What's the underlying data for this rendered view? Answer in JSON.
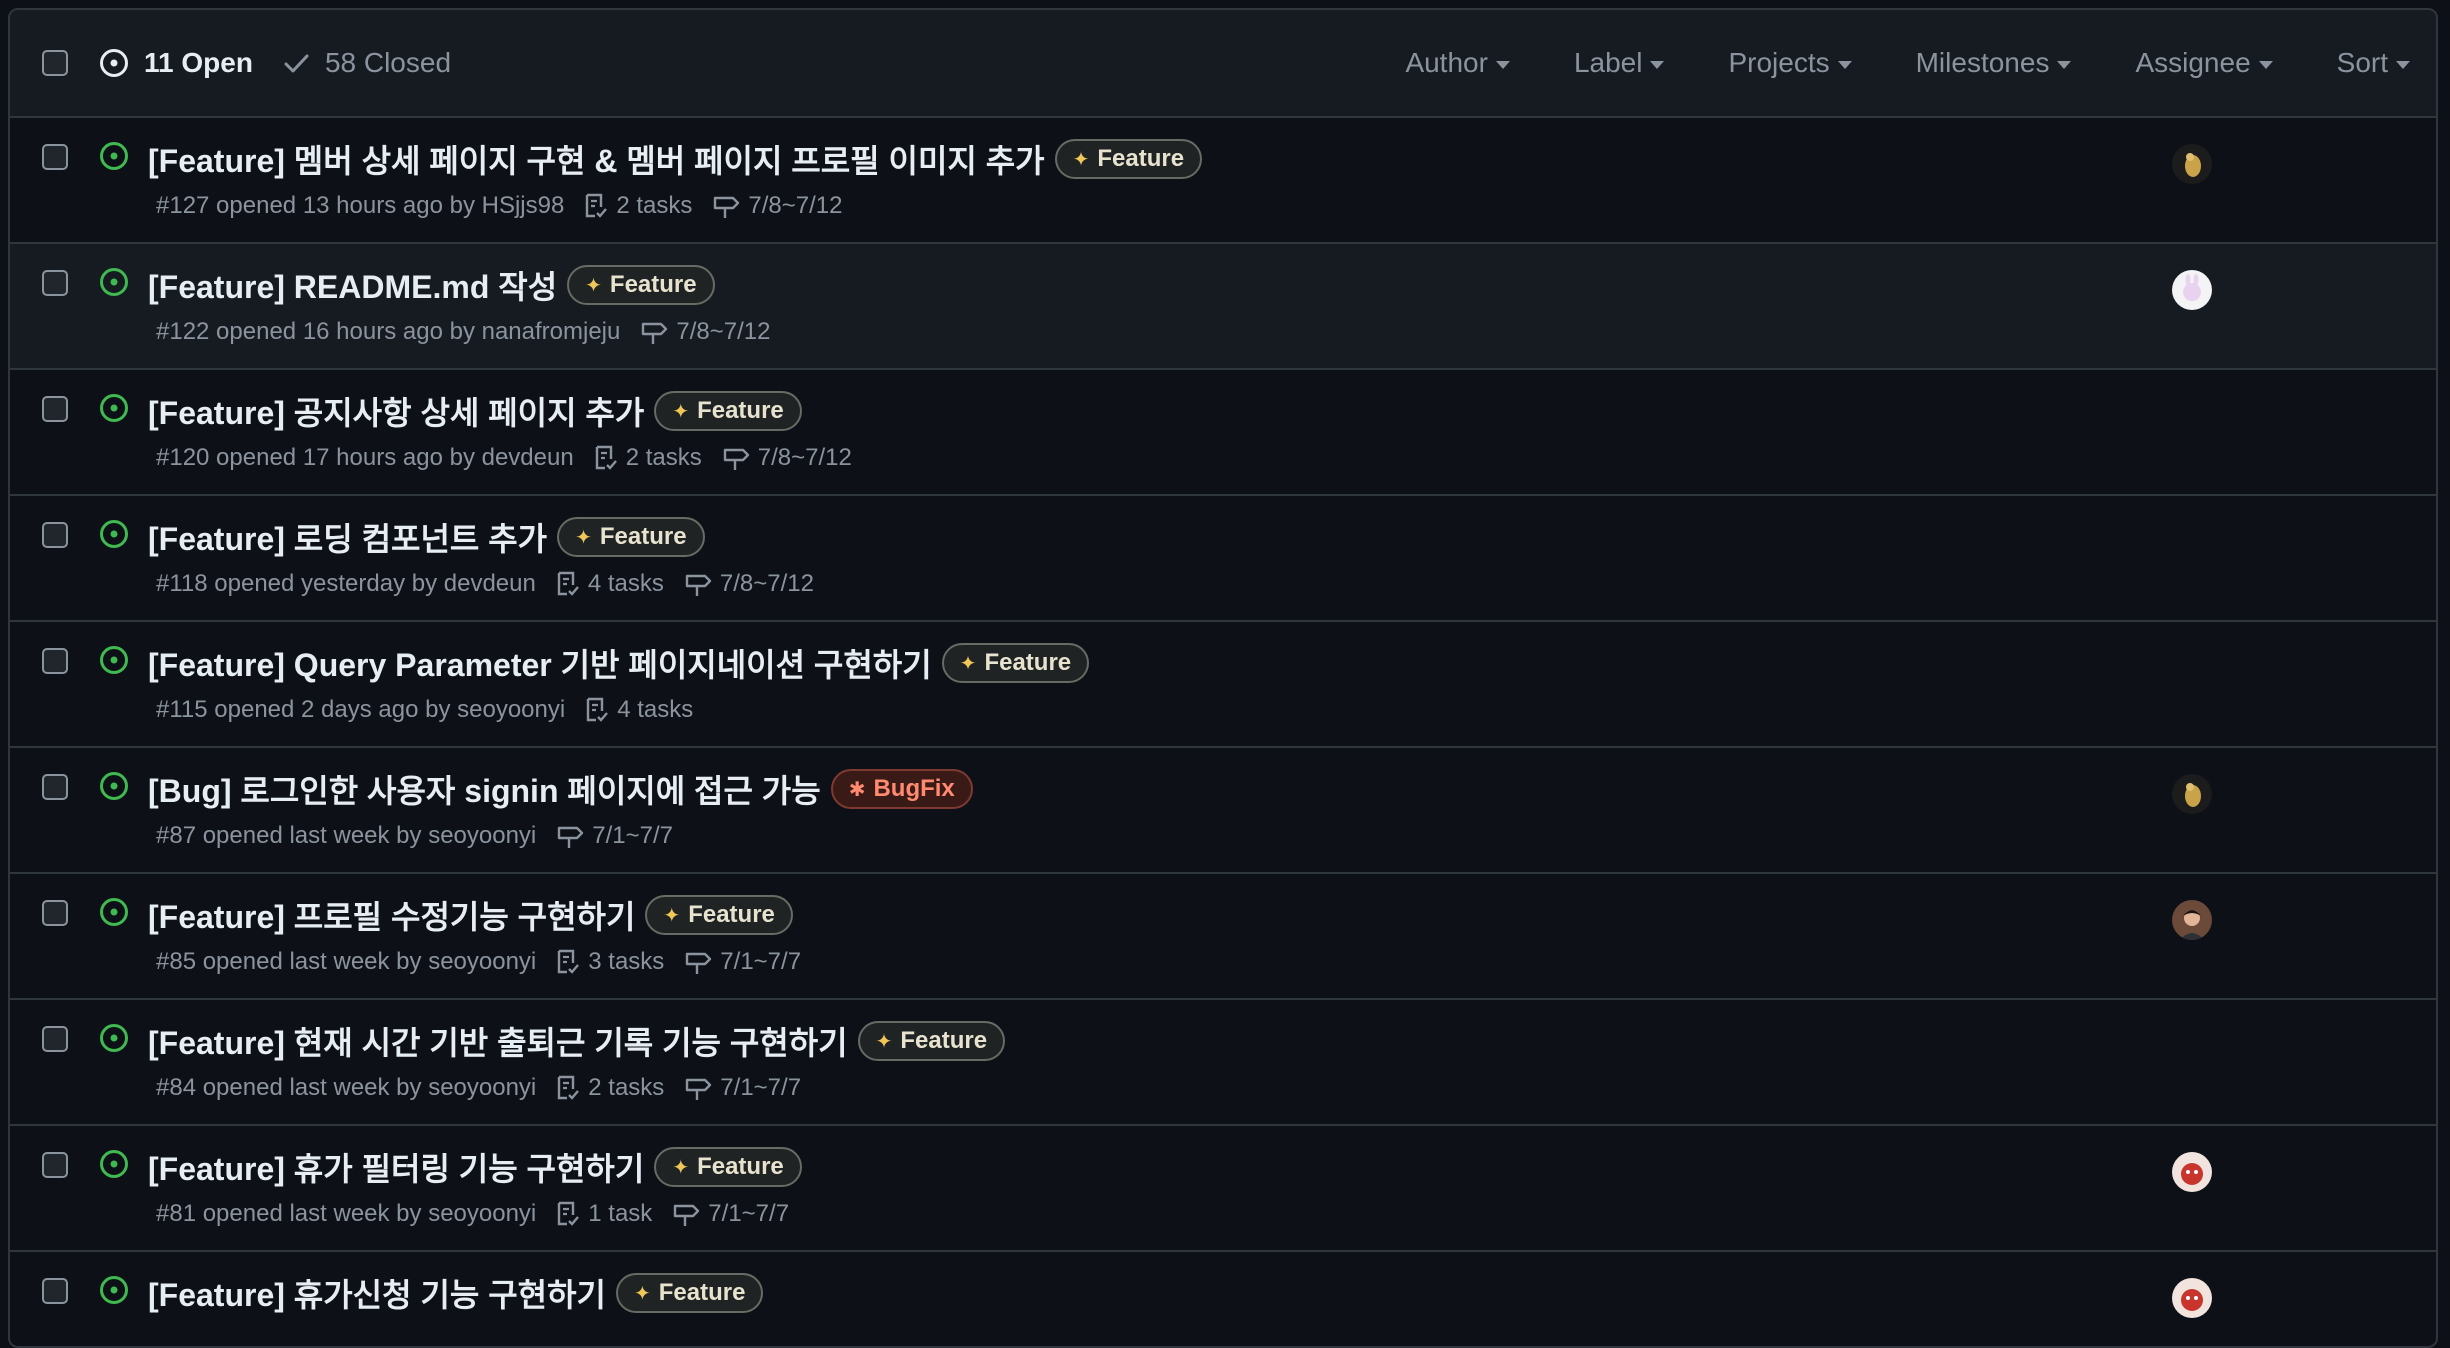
{
  "header": {
    "open_label": "11 Open",
    "closed_label": "58 Closed",
    "filters": [
      "Author",
      "Label",
      "Projects",
      "Milestones",
      "Assignee",
      "Sort"
    ]
  },
  "issues": [
    {
      "title": "[Feature] 멤버 상세 페이지 구현 & 멤버 페이지 프로필 이미지 추가",
      "label": "Feature",
      "meta": "#127 opened 13 hours ago by HSjjs98",
      "tasks": "2 tasks",
      "milestone": "7/8~7/12",
      "avatar": "bird"
    },
    {
      "title": "[Feature] README.md 작성",
      "label": "Feature",
      "meta": "#122 opened 16 hours ago by nanafromjeju",
      "tasks": "",
      "milestone": "7/8~7/12",
      "avatar": "rabbit"
    },
    {
      "title": "[Feature] 공지사항 상세 페이지 추가",
      "label": "Feature",
      "meta": "#120 opened 17 hours ago by devdeun",
      "tasks": "2 tasks",
      "milestone": "7/8~7/12",
      "avatar": ""
    },
    {
      "title": "[Feature] 로딩 컴포넌트 추가",
      "label": "Feature",
      "meta": "#118 opened yesterday by devdeun",
      "tasks": "4 tasks",
      "milestone": "7/8~7/12",
      "avatar": ""
    },
    {
      "title": "[Feature] Query Parameter 기반 페이지네이션 구현하기",
      "label": "Feature",
      "meta": "#115 opened 2 days ago by seoyoonyi",
      "tasks": "4 tasks",
      "milestone": "",
      "avatar": ""
    },
    {
      "title": "[Bug] 로그인한 사용자 signin 페이지에 접근 가능",
      "label": "BugFix",
      "meta": "#87 opened last week by seoyoonyi",
      "tasks": "",
      "milestone": "7/1~7/7",
      "avatar": "bird"
    },
    {
      "title": "[Feature] 프로필 수정기능 구현하기",
      "label": "Feature",
      "meta": "#85 opened last week by seoyoonyi",
      "tasks": "3 tasks",
      "milestone": "7/1~7/7",
      "avatar": "person"
    },
    {
      "title": "[Feature] 현재 시간 기반 출퇴근 기록 기능 구현하기",
      "label": "Feature",
      "meta": "#84 opened last week by seoyoonyi",
      "tasks": "2 tasks",
      "milestone": "7/1~7/7",
      "avatar": ""
    },
    {
      "title": "[Feature] 휴가 필터링 기능 구현하기",
      "label": "Feature",
      "meta": "#81 opened last week by seoyoonyi",
      "tasks": "1 task",
      "milestone": "7/1~7/7",
      "avatar": "red"
    },
    {
      "title": "[Feature] 휴가신청 기능 구현하기",
      "label": "Feature",
      "meta": "",
      "tasks": "",
      "milestone": "",
      "avatar": "red"
    }
  ],
  "colors": {
    "open_icon": "#3fb950",
    "background": "#0d1117",
    "header_bg": "#161b22",
    "border": "#30363d"
  }
}
